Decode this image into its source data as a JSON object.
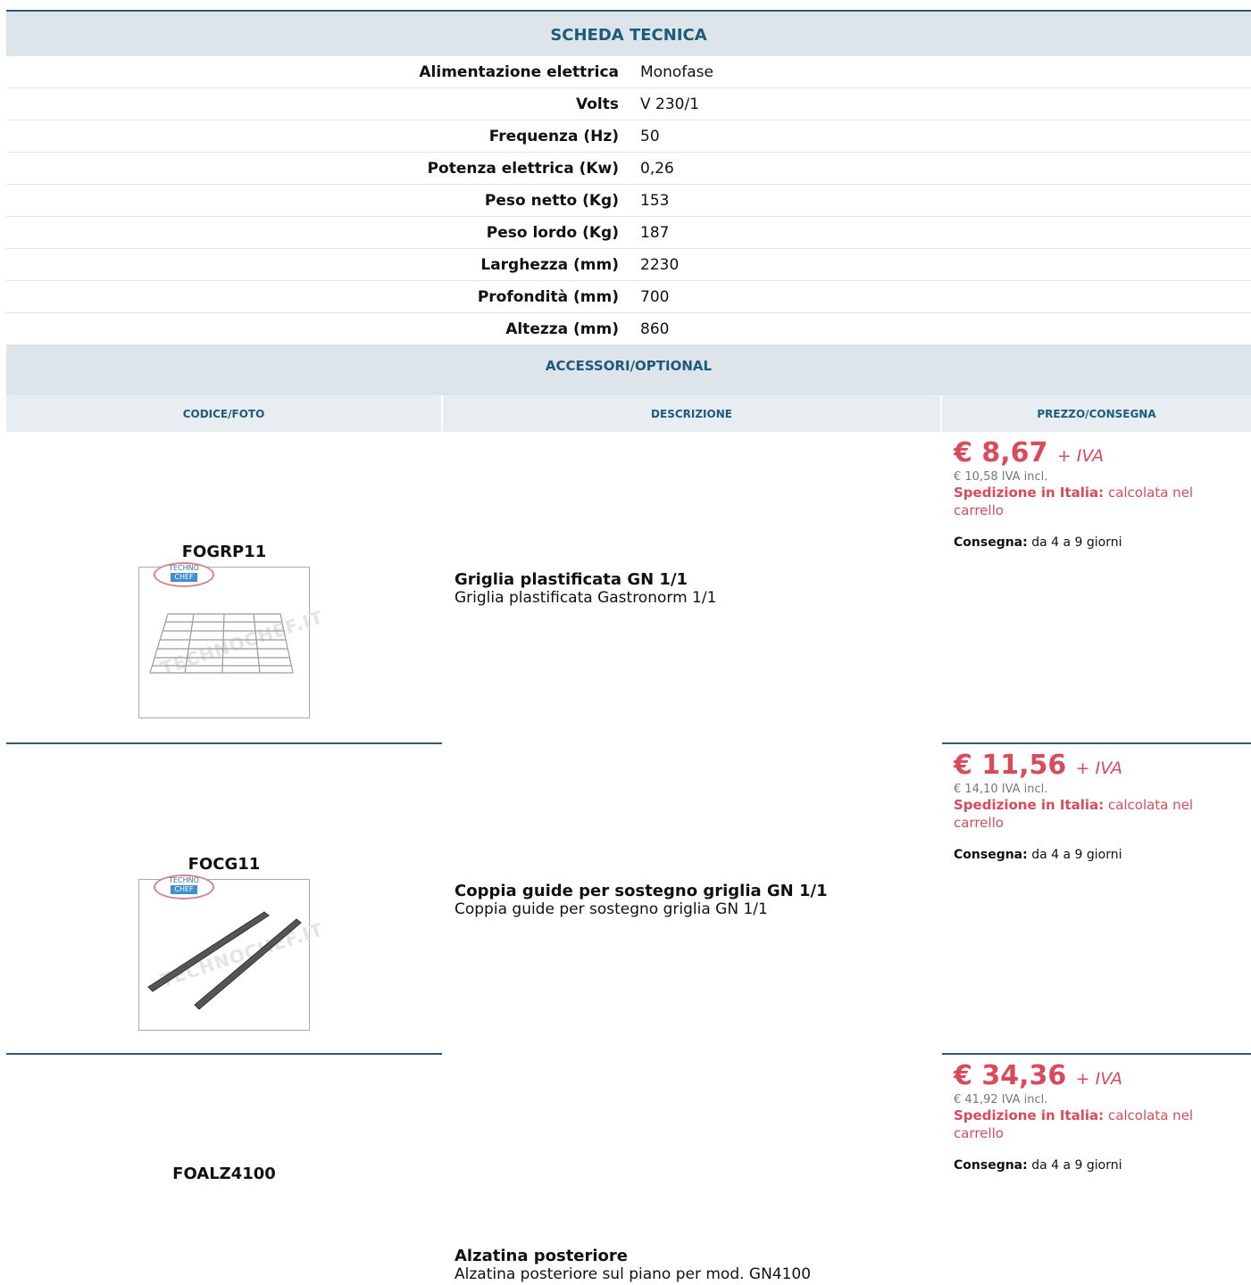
{
  "spec": {
    "title": "SCHEDA TECNICA",
    "rows": [
      {
        "label": "Alimentazione elettrica",
        "value": "Monofase"
      },
      {
        "label": "Volts",
        "value": "V 230/1"
      },
      {
        "label": "Frequenza (Hz)",
        "value": "50"
      },
      {
        "label": "Potenza elettrica (Kw)",
        "value": "0,26"
      },
      {
        "label": "Peso netto (Kg)",
        "value": "153"
      },
      {
        "label": "Peso lordo (Kg)",
        "value": "187"
      },
      {
        "label": "Larghezza (mm)",
        "value": "2230"
      },
      {
        "label": "Profondità (mm)",
        "value": "700"
      },
      {
        "label": "Altezza (mm)",
        "value": "860"
      }
    ]
  },
  "accessories": {
    "title": "ACCESSORI/OPTIONAL",
    "headers": {
      "code": "CODICE/FOTO",
      "desc": "DESCRIZIONE",
      "price": "PREZZO/CONSEGNA"
    },
    "items": [
      {
        "code": "FOGRP11",
        "title": "Griglia plastificata GN 1/1",
        "desc": "Griglia plastificata Gastronorm 1/1",
        "price": "€ 8,67",
        "iva": "+ IVA",
        "incl": "€ 10,58 IVA incl.",
        "ship_label": "Spedizione in Italia:",
        "ship_text": "calcolata nel carrello",
        "delivery_label": "Consegna:",
        "delivery_text": "da 4 a 9 giorni"
      },
      {
        "code": "FOCG11",
        "title": "Coppia guide per sostegno griglia GN 1/1",
        "desc": "Coppia guide per sostegno griglia GN 1/1",
        "price": "€ 11,56",
        "iva": "+ IVA",
        "incl": "€ 14,10 IVA incl.",
        "ship_label": "Spedizione in Italia:",
        "ship_text": "calcolata nel carrello",
        "delivery_label": "Consegna:",
        "delivery_text": "da 4 a 9 giorni"
      },
      {
        "code": "FOALZ4100",
        "title": "Alzatina posteriore",
        "desc": "Alzatina posteriore sul piano per mod. GN4100",
        "price": "€ 34,36",
        "iva": "+ IVA",
        "incl": "€ 41,92 IVA incl.",
        "ship_label": "Spedizione in Italia:",
        "ship_text": "calcolata nel carrello",
        "delivery_label": "Consegna:",
        "delivery_text": "da 4 a 9 giorni"
      }
    ]
  },
  "thumb": {
    "logo_top": "TECHNO",
    "logo_bottom": "CHEF",
    "watermark": "TECHNOCHEF.IT"
  }
}
